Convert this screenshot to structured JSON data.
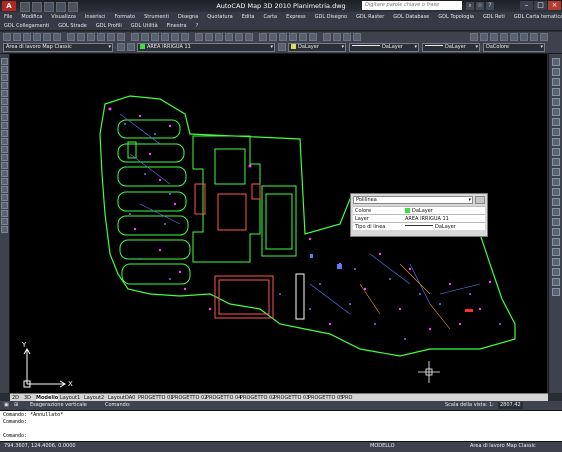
{
  "app": {
    "title": "AutoCAD Map 3D 2010    Planimetria.dwg",
    "logo": "A",
    "search_placeholder": "Digitare parole chiave o frase"
  },
  "menu": {
    "row1": [
      "File",
      "Modifica",
      "Visualizza",
      "Inserisci",
      "Formato",
      "Strumenti",
      "Disegna",
      "Quotatura",
      "Edita",
      "Carta",
      "Express",
      "GDL Disegno",
      "GDL Raster",
      "GDL Database",
      "GDL Topologia",
      "GDL Reti",
      "GDL Carta tematica"
    ],
    "row2": [
      "GDL Collegamenti",
      "GDL Strade",
      "GDL Profili",
      "GDL Utilità",
      "Finestra",
      "?"
    ]
  },
  "toolbar": {
    "workspace": "Area di lavoro Map Classic",
    "layer": "AREA IRRIGUA 11",
    "color": "DaLayer",
    "linetype1": "DaLayer",
    "linetype2": "DaLayer",
    "lineweight": "DaColore"
  },
  "properties_popup": {
    "object_type": "Polilinea",
    "rows": [
      {
        "key": "Colore",
        "value": "DaLayer"
      },
      {
        "key": "Layer",
        "value": "AREA IRRIGUA 11"
      },
      {
        "key": "Tipo di linea",
        "value": "DaLayer"
      }
    ]
  },
  "tabs": [
    "2D",
    "3D",
    "Modello",
    "Layout1",
    "Layout2",
    "LayoutDA0",
    "PROGETTO 01",
    "PROGETTO 02",
    "PROGETTO 04",
    "PROGETTO 02",
    "PROGETTO 03",
    "PROGETTO 05",
    "PRO"
  ],
  "statusrow": {
    "esagerazione": "Esagerazione verticale",
    "comando": "Comando:",
    "scala_label": "Scala della vista: 1:",
    "scala_value": "2807.42"
  },
  "command": {
    "lines": [
      "Comando: *Annullato*",
      "Comando:",
      "",
      "Comando:"
    ]
  },
  "bottom": {
    "coords": "794.3607, 124.4006, 0.0000",
    "mode": "MODELLO",
    "workspace": "Area di lavoro Map Classic"
  },
  "colors": {
    "boundary": "#3fff3f",
    "building": "#ff5555",
    "background": "#000000"
  }
}
